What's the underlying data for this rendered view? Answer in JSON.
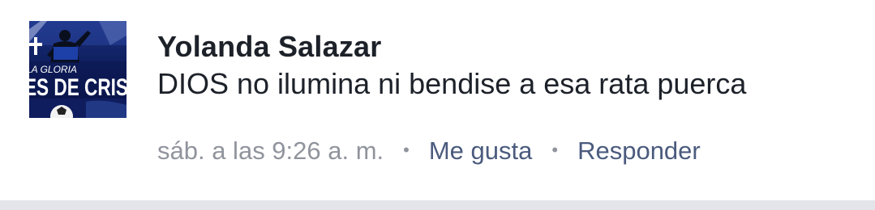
{
  "comment": {
    "author": "Yolanda Salazar",
    "text": "DIOS no ilumina ni bendise a esa rata puerca",
    "timestamp": "sáb. a las 9:26 a. m.",
    "separator": "•",
    "like_label": "Me gusta",
    "reply_label": "Responder",
    "avatar": {
      "line1": "LA GLORIA",
      "line2": "ES DE CRIS",
      "icon": "profile-photo"
    }
  },
  "colors": {
    "author": "#1d2129",
    "text": "#1d2129",
    "timestamp": "#90949c",
    "action": "#4b5b7e",
    "divider": "#e4e5ea"
  }
}
